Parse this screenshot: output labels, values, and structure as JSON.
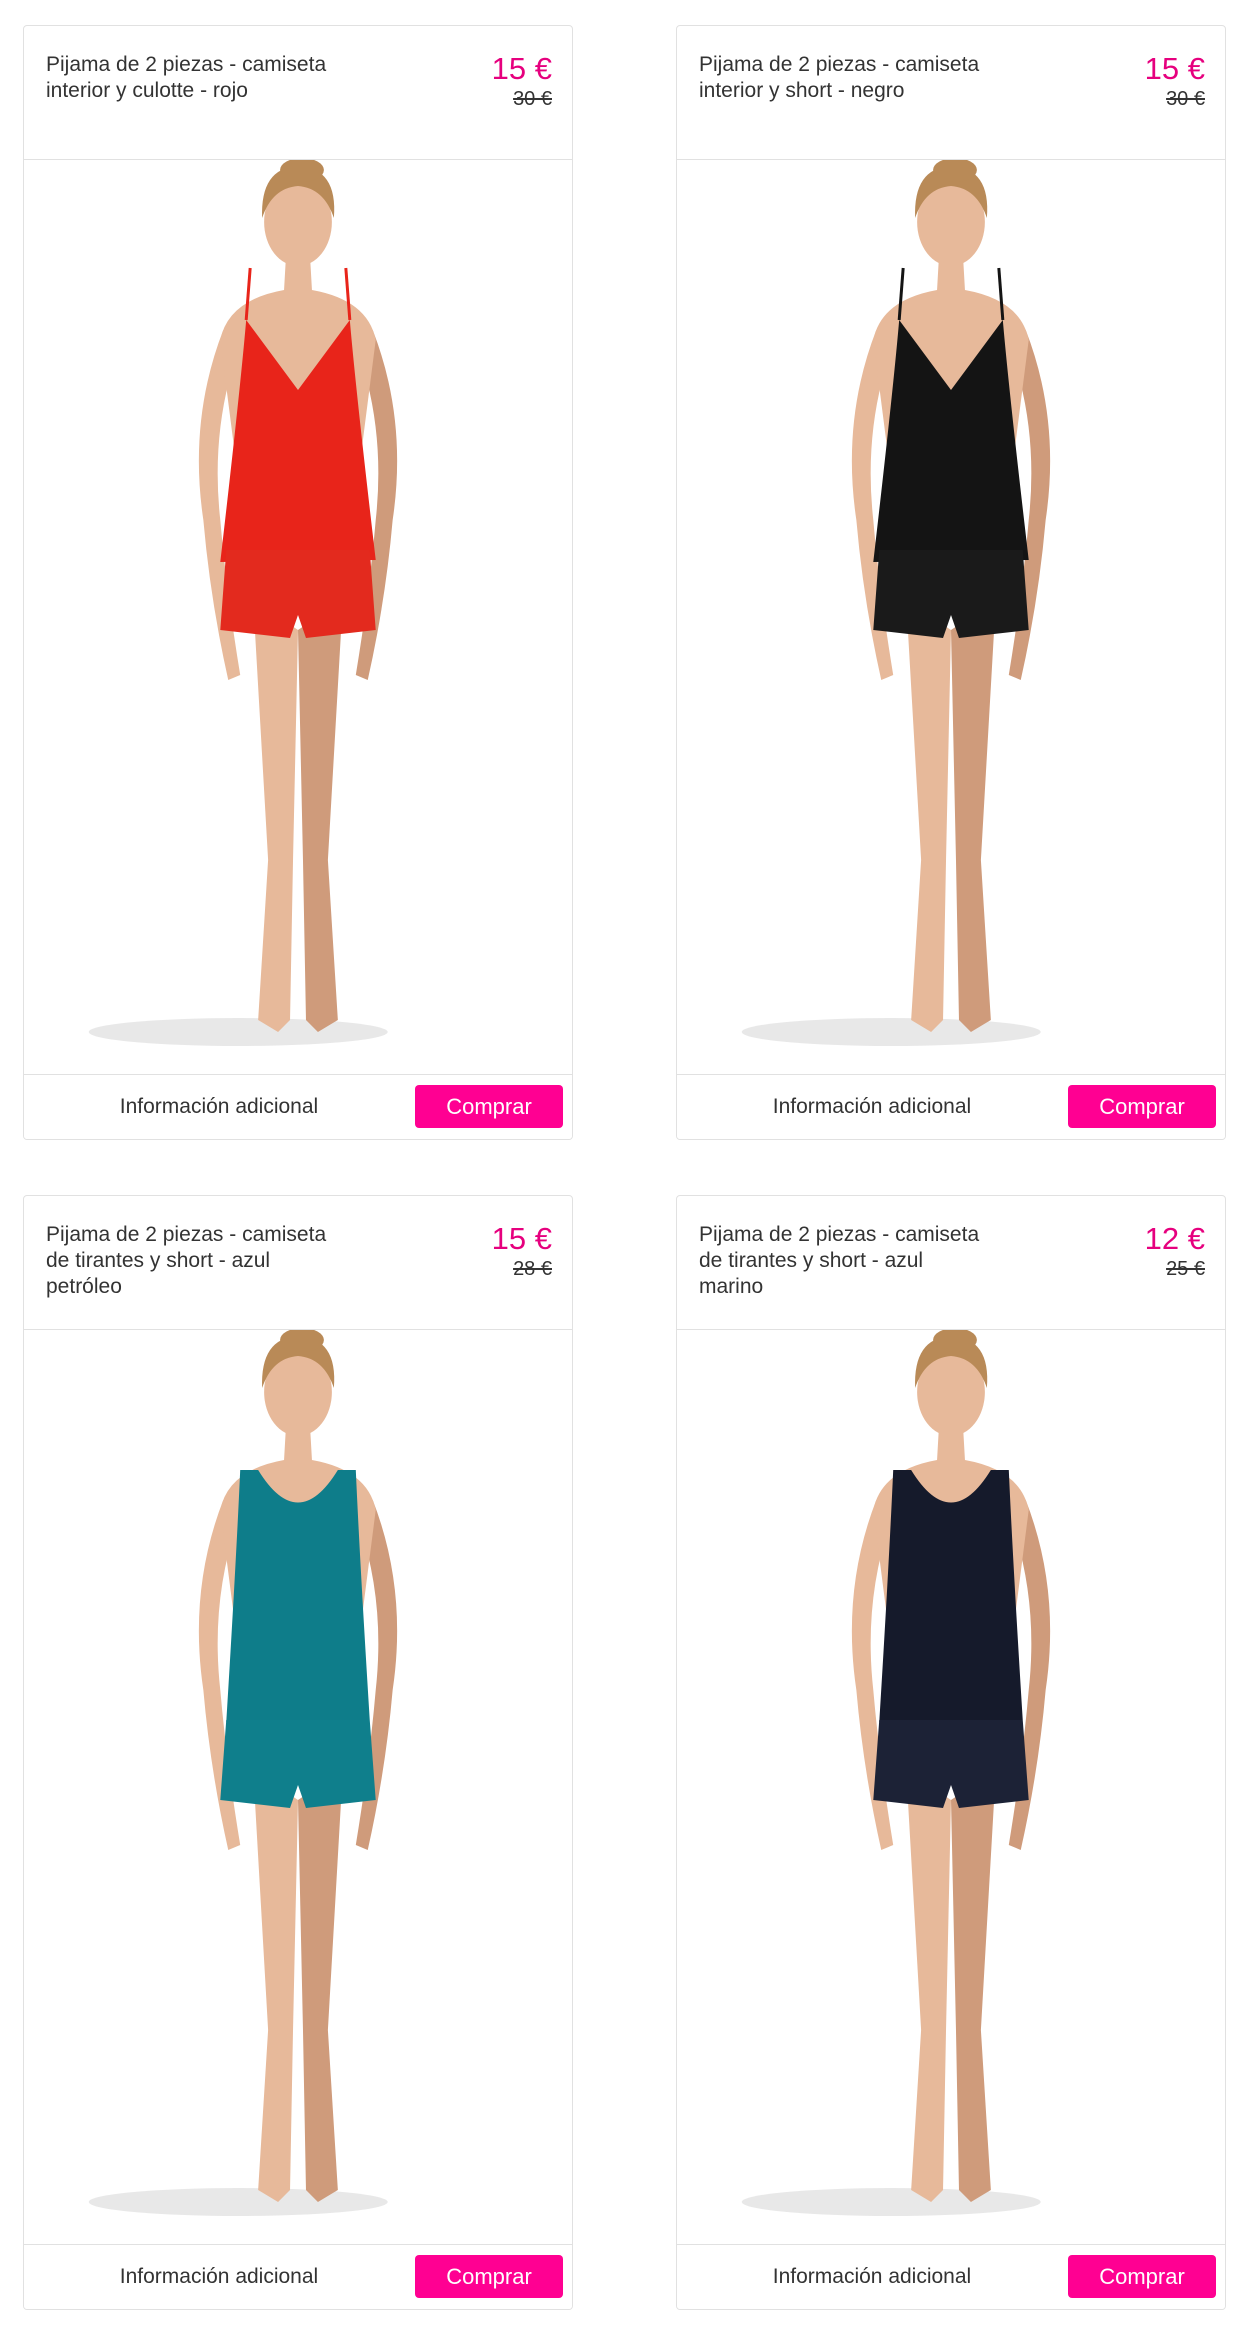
{
  "products": [
    {
      "title": "Pijama de 2 piezas - camiseta interior y culotte - rojo",
      "price": "15 €",
      "old_price": "30 €",
      "info_label": "Información adicional",
      "buy_label": "Comprar",
      "image": "model-red-satin-camisole-pajama",
      "colors": {
        "top": "#e8241a",
        "bottom": "#e32a1e"
      }
    },
    {
      "title": "Pijama de 2 piezas - camiseta interior y short - negro",
      "price": "15 €",
      "old_price": "30 €",
      "info_label": "Información adicional",
      "buy_label": "Comprar",
      "image": "model-black-satin-camisole-pajama",
      "colors": {
        "top": "#141414",
        "bottom": "#1a1a1a"
      }
    },
    {
      "title": "Pijama de 2 piezas - camiseta de tirantes y short - azul petróleo",
      "price": "15 €",
      "old_price": "28 €",
      "info_label": "Información adicional",
      "buy_label": "Comprar",
      "image": "model-teal-tank-pajama",
      "colors": {
        "top": "#0e7d8a",
        "bottom": "#0f7f8c"
      }
    },
    {
      "title": "Pijama de 2 piezas - camiseta de tirantes y short - azul marino",
      "price": "12 €",
      "old_price": "25 €",
      "info_label": "Información adicional",
      "buy_label": "Comprar",
      "image": "model-navy-tank-pajama",
      "colors": {
        "top": "#151a2b",
        "bottom": "#1c2236"
      }
    }
  ],
  "brand_color": "#ff0092",
  "price_color": "#e6007e"
}
